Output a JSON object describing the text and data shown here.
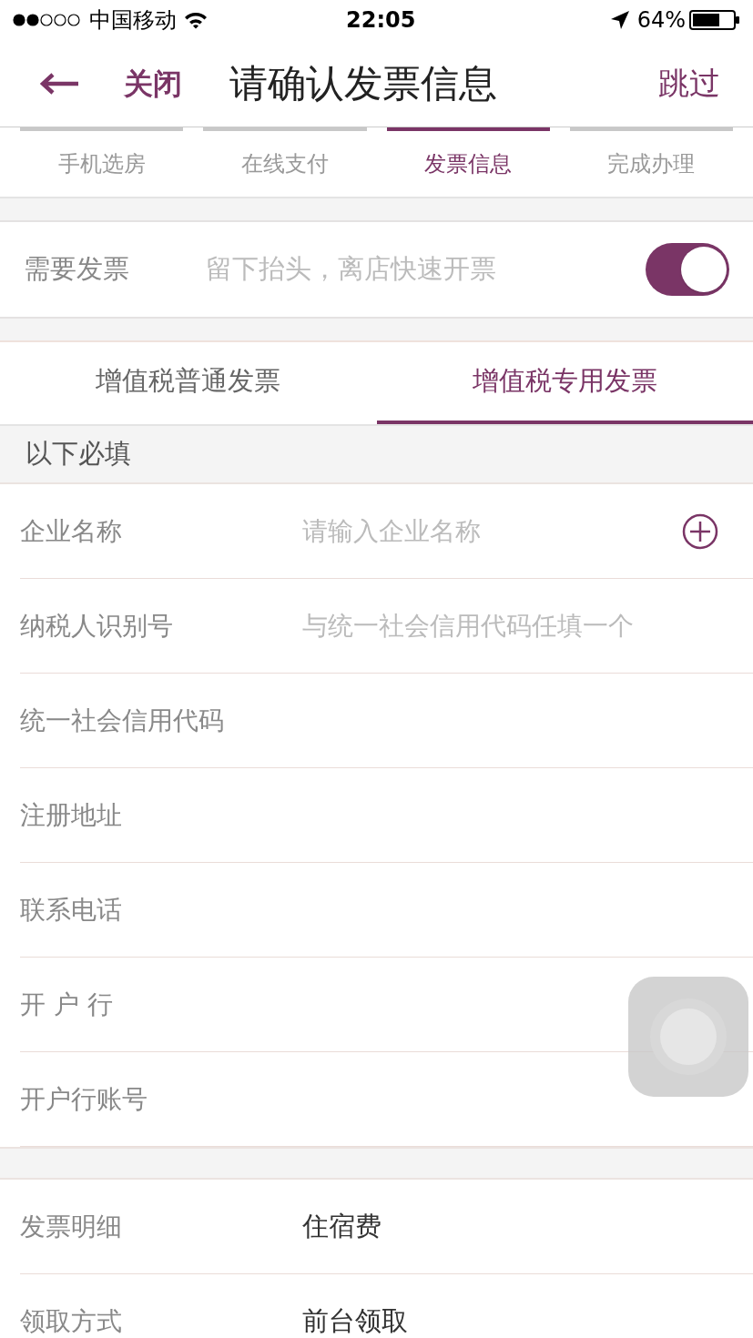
{
  "status_bar": {
    "carrier": "中国移动",
    "time": "22:05",
    "battery": "64%"
  },
  "nav": {
    "back_label": "关闭",
    "title": "请确认发票信息",
    "skip_label": "跳过"
  },
  "steps": [
    {
      "label": "手机选房",
      "selected": false
    },
    {
      "label": "在线支付",
      "selected": false
    },
    {
      "label": "发票信息",
      "selected": true
    },
    {
      "label": "完成办理",
      "selected": false
    }
  ],
  "invoice_toggle": {
    "label": "需要发票",
    "hint": "留下抬头，离店快速开票",
    "on": true
  },
  "invoice_tabs": [
    {
      "label": "增值税普通发票",
      "selected": false
    },
    {
      "label": "增值税专用发票",
      "selected": true
    }
  ],
  "required_header": "以下必填",
  "fields": [
    {
      "label": "企业名称",
      "placeholder": "请输入企业名称",
      "kind": "picker"
    },
    {
      "label": "纳税人识别号",
      "placeholder": "与统一社会信用代码任填一个",
      "kind": "text"
    },
    {
      "label": "统一社会信用代码",
      "kind": "text"
    },
    {
      "label": "注册地址",
      "kind": "text"
    },
    {
      "label": "联系电话",
      "kind": "text"
    },
    {
      "label": "开 户 行",
      "kind": "text"
    },
    {
      "label": "开户行账号",
      "kind": "text"
    }
  ],
  "details": [
    {
      "label": "发票明细",
      "value": "住宿费"
    },
    {
      "label": "领取方式",
      "value": "前台领取"
    }
  ]
}
